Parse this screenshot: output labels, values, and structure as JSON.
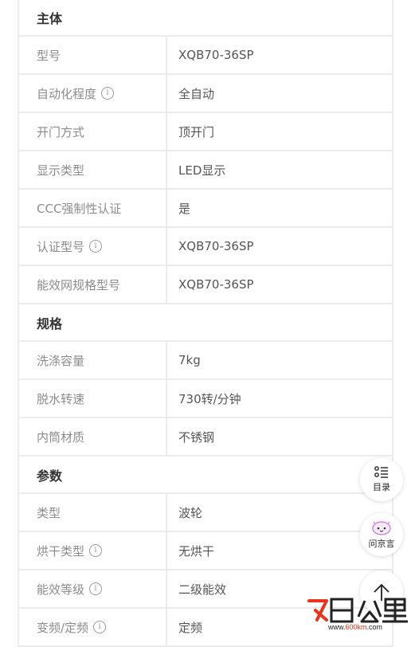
{
  "sections": [
    {
      "title": "主体",
      "rows": [
        {
          "label": "型号",
          "value": "XQB70-36SP",
          "info": false
        },
        {
          "label": "自动化程度",
          "value": "全自动",
          "info": true
        },
        {
          "label": "开门方式",
          "value": "顶开门",
          "info": false
        },
        {
          "label": "显示类型",
          "value": "LED显示",
          "info": false
        },
        {
          "label": "CCC强制性认证",
          "value": "是",
          "info": false
        },
        {
          "label": "认证型号",
          "value": "XQB70-36SP",
          "info": true
        },
        {
          "label": "能效网规格型号",
          "value": "XQB70-36SP",
          "info": false
        }
      ]
    },
    {
      "title": "规格",
      "rows": [
        {
          "label": "洗涤容量",
          "value": "7kg",
          "info": false
        },
        {
          "label": "脱水转速",
          "value": "730转/分钟",
          "info": false
        },
        {
          "label": "内筒材质",
          "value": "不锈钢",
          "info": false
        }
      ]
    },
    {
      "title": "参数",
      "rows": [
        {
          "label": "类型",
          "value": "波轮",
          "info": false
        },
        {
          "label": "烘干类型",
          "value": "无烘干",
          "info": true
        },
        {
          "label": "能效等级",
          "value": "二级能效",
          "info": true
        },
        {
          "label": "变频/定频",
          "value": "定频",
          "info": true
        }
      ]
    }
  ],
  "info_icon_glyph": "i",
  "float_buttons": {
    "toc_label": "目录",
    "ask_label": "问京言"
  },
  "watermark": {
    "logo_text": "百公里",
    "url_prefix": "www.",
    "url_accent": "600km",
    "url_suffix": ".com"
  },
  "colors": {
    "accent": "#e8341c",
    "border": "#ececec",
    "label": "#8c8c8c"
  }
}
